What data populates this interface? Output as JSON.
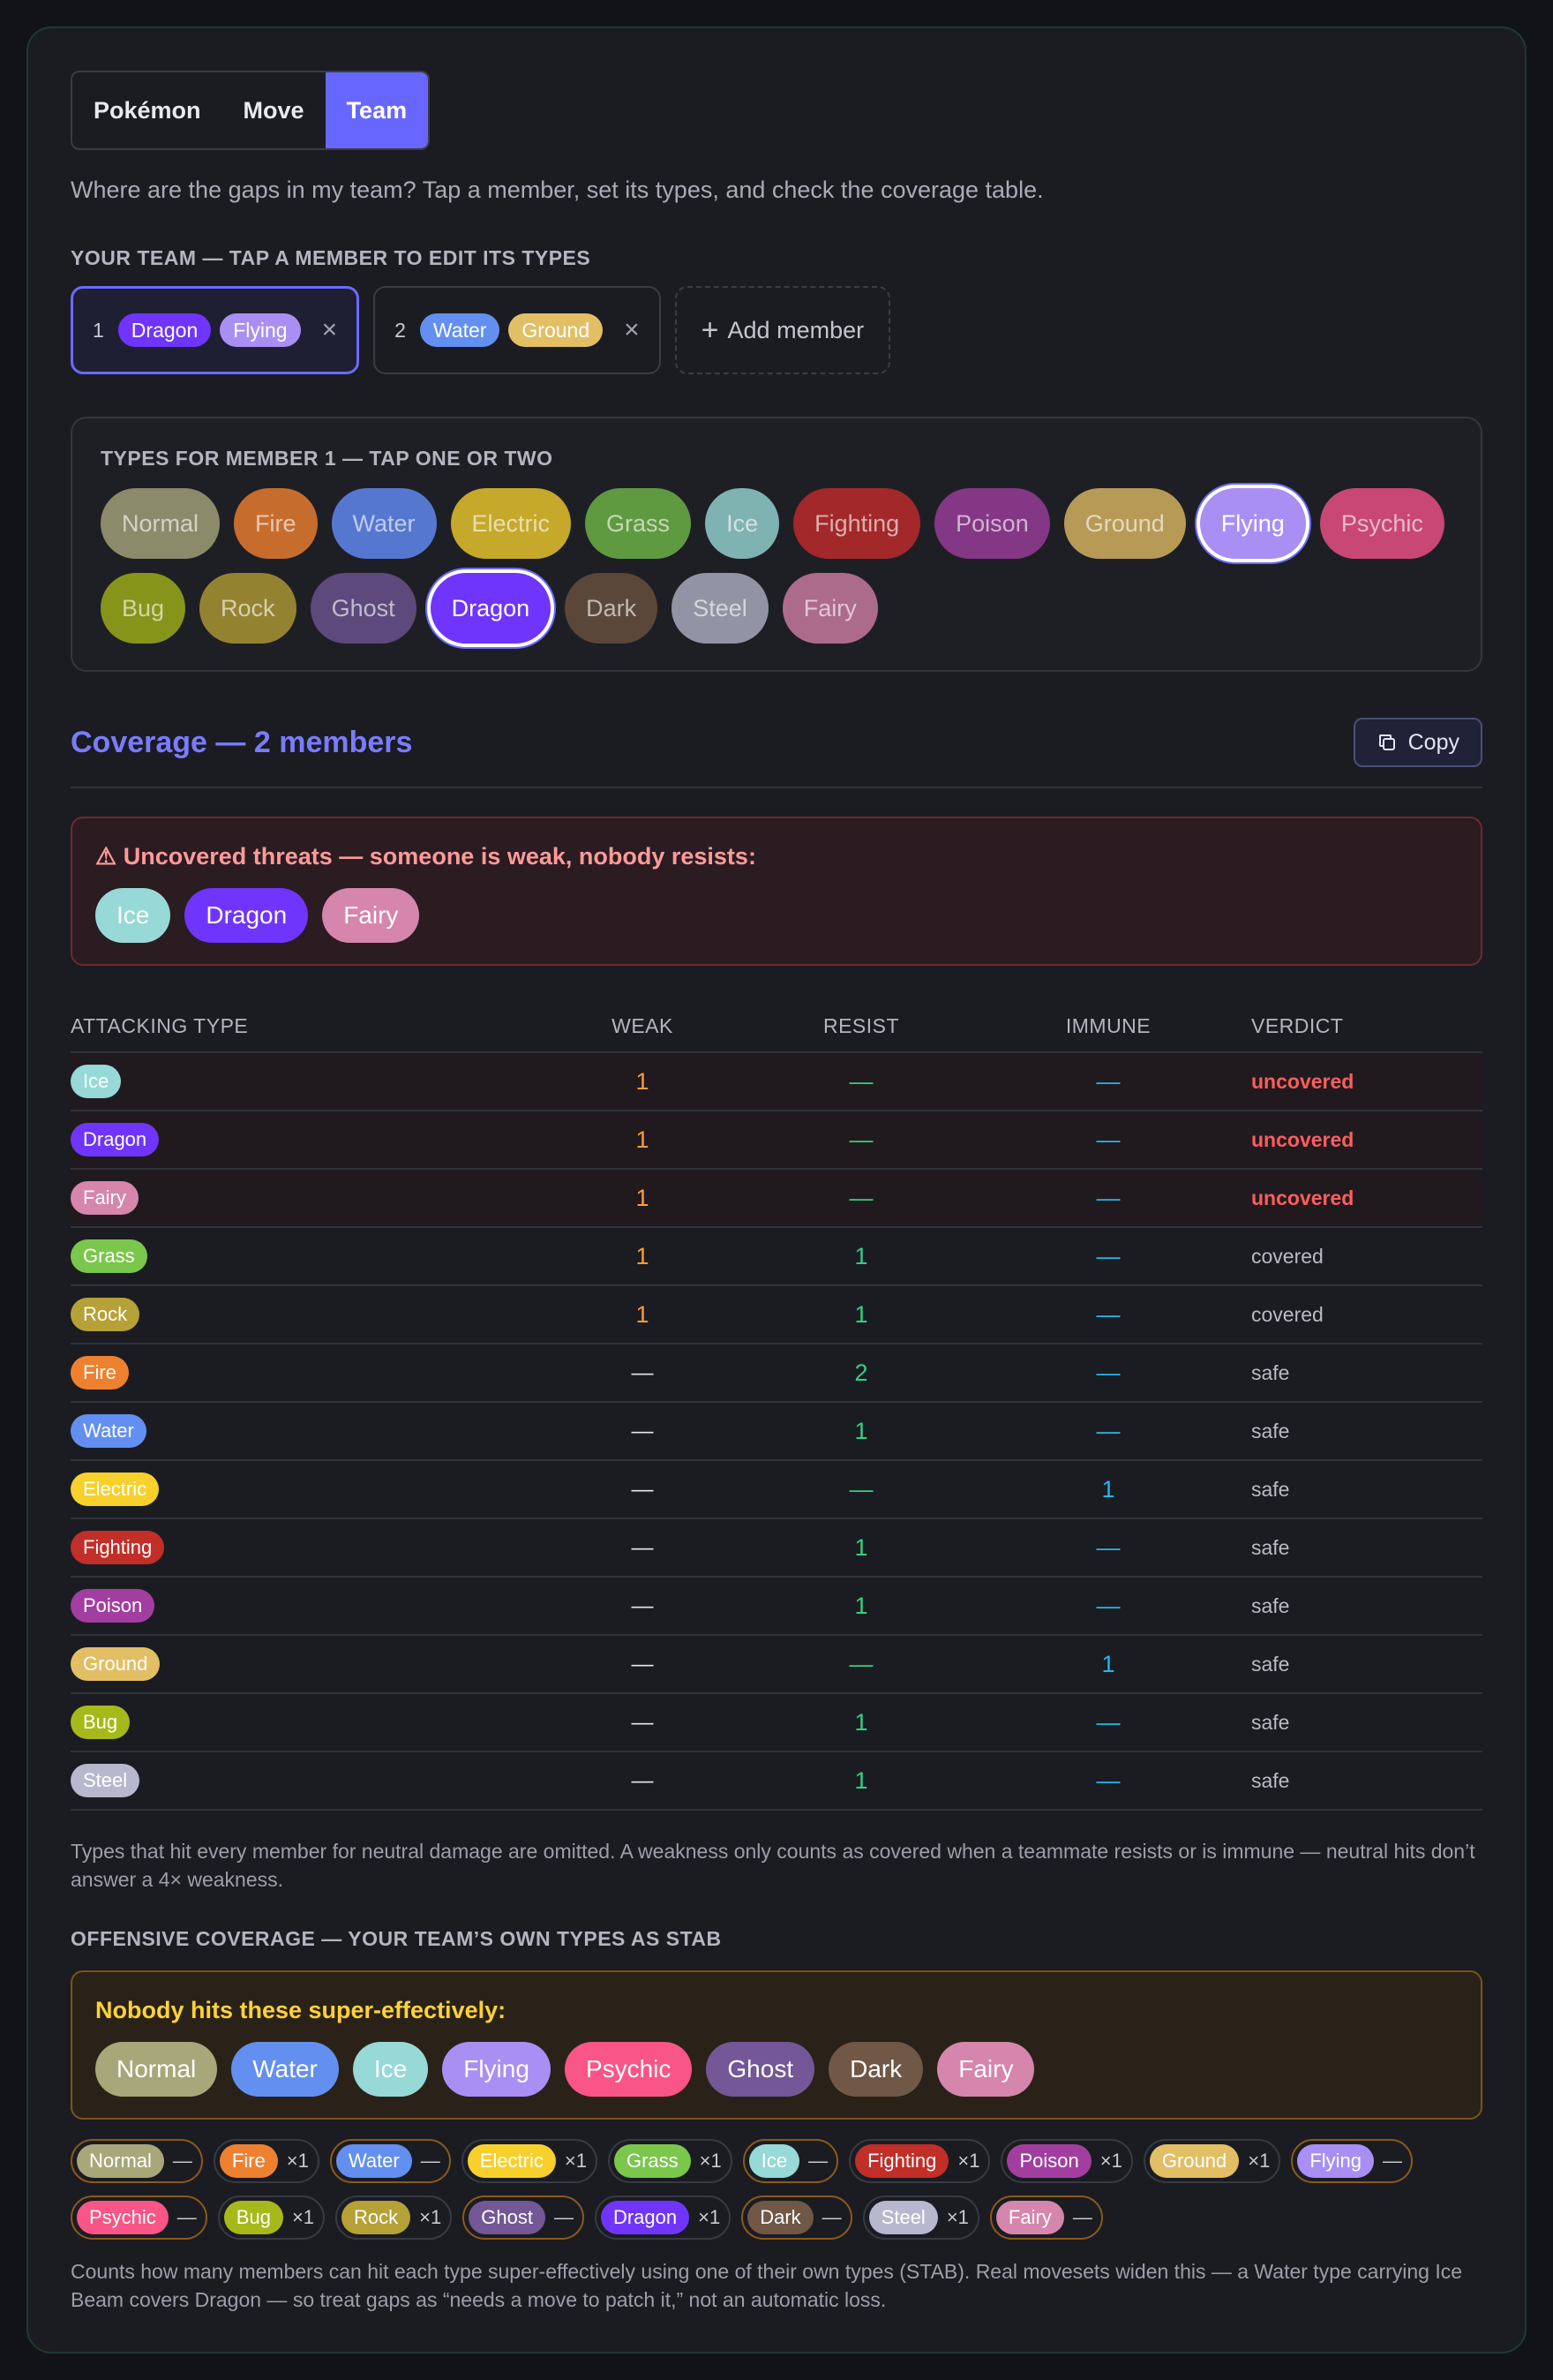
{
  "tabs": [
    {
      "label": "Pokémon"
    },
    {
      "label": "Move"
    },
    {
      "label": "Team"
    }
  ],
  "intro": "Where are the gaps in my team? Tap a member, set its types, and check the coverage table.",
  "team": {
    "label": "YOUR TEAM — TAP A MEMBER TO EDIT ITS TYPES",
    "members": [
      {
        "num": "1",
        "types": [
          "Dragon",
          "Flying"
        ],
        "remove": "×"
      },
      {
        "num": "2",
        "types": [
          "Water",
          "Ground"
        ],
        "remove": "×"
      }
    ],
    "add_label": "Add member",
    "add_icon": "+"
  },
  "types_box": {
    "label": "TYPES FOR MEMBER 1 — TAP ONE OR TWO",
    "types": [
      "Normal",
      "Fire",
      "Water",
      "Electric",
      "Grass",
      "Ice",
      "Fighting",
      "Poison",
      "Ground",
      "Flying",
      "Psychic",
      "Bug",
      "Rock",
      "Ghost",
      "Dragon",
      "Dark",
      "Steel",
      "Fairy"
    ],
    "selected": [
      "Flying",
      "Dragon"
    ]
  },
  "coverage": {
    "title": "Coverage — 2 members",
    "copy_label": "Copy",
    "warn_title": "⚠ Uncovered threats — someone is weak, nobody resists:",
    "threats": [
      "Ice",
      "Dragon",
      "Fairy"
    ],
    "headers": {
      "type": "ATTACKING TYPE",
      "weak": "WEAK",
      "resist": "RESIST",
      "immune": "IMMUNE",
      "verdict": "VERDICT"
    },
    "rows": [
      {
        "type": "Ice",
        "weak": "1",
        "resist": "—",
        "immune": "—",
        "verdict": "uncovered"
      },
      {
        "type": "Dragon",
        "weak": "1",
        "resist": "—",
        "immune": "—",
        "verdict": "uncovered"
      },
      {
        "type": "Fairy",
        "weak": "1",
        "resist": "—",
        "immune": "—",
        "verdict": "uncovered"
      },
      {
        "type": "Grass",
        "weak": "1",
        "resist": "1",
        "immune": "—",
        "verdict": "covered"
      },
      {
        "type": "Rock",
        "weak": "1",
        "resist": "1",
        "immune": "—",
        "verdict": "covered"
      },
      {
        "type": "Fire",
        "weak": "—",
        "resist": "2",
        "immune": "—",
        "verdict": "safe"
      },
      {
        "type": "Water",
        "weak": "—",
        "resist": "1",
        "immune": "—",
        "verdict": "safe"
      },
      {
        "type": "Electric",
        "weak": "—",
        "resist": "—",
        "immune": "1",
        "verdict": "safe"
      },
      {
        "type": "Fighting",
        "weak": "—",
        "resist": "1",
        "immune": "—",
        "verdict": "safe"
      },
      {
        "type": "Poison",
        "weak": "—",
        "resist": "1",
        "immune": "—",
        "verdict": "safe"
      },
      {
        "type": "Ground",
        "weak": "—",
        "resist": "—",
        "immune": "1",
        "verdict": "safe"
      },
      {
        "type": "Bug",
        "weak": "—",
        "resist": "1",
        "immune": "—",
        "verdict": "safe"
      },
      {
        "type": "Steel",
        "weak": "—",
        "resist": "1",
        "immune": "—",
        "verdict": "safe"
      }
    ],
    "note": "Types that hit every member for neutral damage are omitted. A weakness only counts as covered when a teammate resists or is immune — neutral hits don’t answer a 4× weakness."
  },
  "offense": {
    "label": "OFFENSIVE COVERAGE — YOUR TEAM’S OWN TYPES AS STAB",
    "gap_title": "Nobody hits these super-effectively:",
    "gaps": [
      "Normal",
      "Water",
      "Ice",
      "Flying",
      "Psychic",
      "Ghost",
      "Dark",
      "Fairy"
    ],
    "counts": [
      {
        "type": "Normal",
        "n": "—"
      },
      {
        "type": "Fire",
        "n": "×1"
      },
      {
        "type": "Water",
        "n": "—"
      },
      {
        "type": "Electric",
        "n": "×1"
      },
      {
        "type": "Grass",
        "n": "×1"
      },
      {
        "type": "Ice",
        "n": "—"
      },
      {
        "type": "Fighting",
        "n": "×1"
      },
      {
        "type": "Poison",
        "n": "×1"
      },
      {
        "type": "Ground",
        "n": "×1"
      },
      {
        "type": "Flying",
        "n": "—"
      },
      {
        "type": "Psychic",
        "n": "—"
      },
      {
        "type": "Bug",
        "n": "×1"
      },
      {
        "type": "Rock",
        "n": "×1"
      },
      {
        "type": "Ghost",
        "n": "—"
      },
      {
        "type": "Dragon",
        "n": "×1"
      },
      {
        "type": "Dark",
        "n": "—"
      },
      {
        "type": "Steel",
        "n": "×1"
      },
      {
        "type": "Fairy",
        "n": "—"
      }
    ],
    "foot": "Counts how many members can hit each type super-effectively using one of their own types (STAB). Real movesets widen this — a Water type carrying Ice Beam covers Dragon — so treat gaps as “needs a move to patch it,” not an automatic loss."
  },
  "colors": {
    "Normal": "#a8a77a",
    "Fire": "#ee8130",
    "Water": "#6390f0",
    "Electric": "#f7d02c",
    "Grass": "#7ac74c",
    "Ice": "#96d9d6",
    "Fighting": "#c22e28",
    "Poison": "#a33ea1",
    "Ground": "#e2bf65",
    "Flying": "#a98ff3",
    "Psychic": "#f95587",
    "Bug": "#a6b91a",
    "Rock": "#b6a136",
    "Ghost": "#735797",
    "Dragon": "#6f35fc",
    "Dark": "#705746",
    "Steel": "#b7b7ce",
    "Fairy": "#d685ad"
  },
  "muted": {
    "Normal": "#8b8a6a",
    "Fire": "#c66d2e",
    "Water": "#5577d0",
    "Electric": "#c6a82a",
    "Grass": "#5f9a40",
    "Ice": "#7fb3b1",
    "Fighting": "#a2282a",
    "Poison": "#833785",
    "Ground": "#b79a55",
    "Flying": "#a98ff3",
    "Psychic": "#c84774",
    "Bug": "#86941a",
    "Rock": "#938330",
    "Ghost": "#5d497b",
    "Dragon": "#6f35fc",
    "Dark": "#5b4739",
    "Steel": "#9293a4",
    "Fairy": "#ad6b8c"
  }
}
